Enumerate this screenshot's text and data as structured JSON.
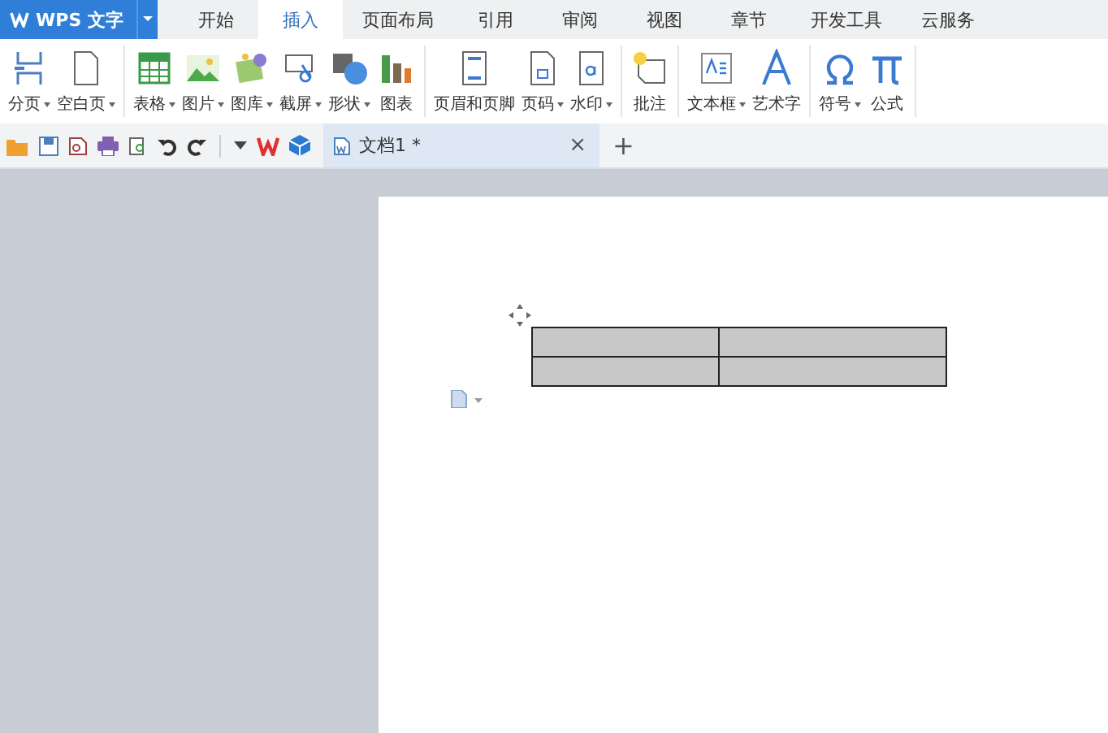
{
  "app_menu": {
    "title": "WPS 文字"
  },
  "tabs": [
    {
      "label": "开始",
      "selected": false
    },
    {
      "label": "插入",
      "selected": true
    },
    {
      "label": "页面布局",
      "selected": false
    },
    {
      "label": "引用",
      "selected": false
    },
    {
      "label": "审阅",
      "selected": false
    },
    {
      "label": "视图",
      "selected": false
    },
    {
      "label": "章节",
      "selected": false
    },
    {
      "label": "开发工具",
      "selected": false
    },
    {
      "label": "云服务",
      "selected": false
    }
  ],
  "ribbon_groups": [
    [
      {
        "label": "分页",
        "dropdown": true
      },
      {
        "label": "空白页",
        "dropdown": true
      }
    ],
    [
      {
        "label": "表格",
        "dropdown": true
      },
      {
        "label": "图片",
        "dropdown": true
      },
      {
        "label": "图库",
        "dropdown": true
      },
      {
        "label": "截屏",
        "dropdown": true
      },
      {
        "label": "形状",
        "dropdown": true
      },
      {
        "label": "图表",
        "dropdown": false
      }
    ],
    [
      {
        "label": "页眉和页脚",
        "dropdown": false
      },
      {
        "label": "页码",
        "dropdown": true
      },
      {
        "label": "水印",
        "dropdown": true
      }
    ],
    [
      {
        "label": "批注",
        "dropdown": false
      }
    ],
    [
      {
        "label": "文本框",
        "dropdown": true
      },
      {
        "label": "艺术字",
        "dropdown": false
      }
    ],
    [
      {
        "label": "符号",
        "dropdown": true
      },
      {
        "label": "公式",
        "dropdown": false
      }
    ]
  ],
  "doc_tab": {
    "title": "文档1 *",
    "close": "×",
    "new_tab": "+"
  },
  "document": {
    "table": {
      "selected": true
    }
  }
}
